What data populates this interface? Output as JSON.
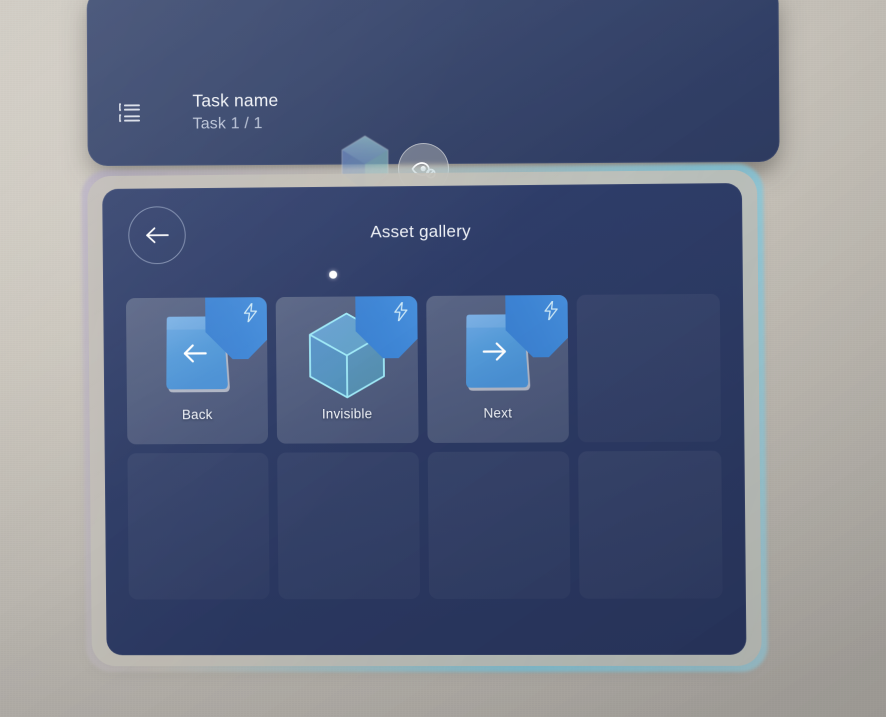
{
  "scene": {
    "environment": "ar-passthrough-wall",
    "wall_color": "#cbc6bd"
  },
  "task_panel": {
    "icon": "task-list-icon",
    "title": "Task name",
    "subtitle": "Task 1 / 1",
    "panel_color": "#334269"
  },
  "floating_controls": {
    "gem": {
      "icon": "gem-crystal-icon"
    },
    "visibility_toggle": {
      "icon": "eye-slash-icon",
      "state": "hidden"
    }
  },
  "gallery": {
    "title": "Asset gallery",
    "back_button_icon": "arrow-left-icon",
    "pointer_icon": "pointer-dot",
    "panel_color": "#2d3b65",
    "accent_color": "#4e95e0",
    "edge_glow_color": "#78c8e1",
    "columns": 4,
    "rows": 2,
    "items": [
      {
        "label": "Back",
        "art": "plate-arrow-left-icon",
        "badge": "lightning-bolt-icon",
        "filled": true
      },
      {
        "label": "Invisible",
        "art": "wireframe-cube-icon",
        "badge": "lightning-bolt-icon",
        "filled": true
      },
      {
        "label": "Next",
        "art": "plate-arrow-right-icon",
        "badge": "lightning-bolt-icon",
        "filled": true
      },
      {
        "label": "",
        "art": "",
        "badge": "",
        "filled": false
      },
      {
        "label": "",
        "art": "",
        "badge": "",
        "filled": false
      },
      {
        "label": "",
        "art": "",
        "badge": "",
        "filled": false
      },
      {
        "label": "",
        "art": "",
        "badge": "",
        "filled": false
      },
      {
        "label": "",
        "art": "",
        "badge": "",
        "filled": false
      }
    ]
  }
}
